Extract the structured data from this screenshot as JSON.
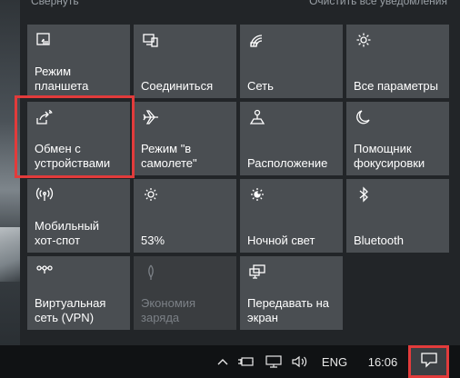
{
  "action_center": {
    "top_left_link": "Свернуть",
    "top_right_link": "Очистить все уведомления"
  },
  "tiles": [
    {
      "label": "Режим\nпланшета",
      "icon": "tablet-mode-icon",
      "disabled": false
    },
    {
      "label": "Соединиться",
      "icon": "connect-icon",
      "disabled": false
    },
    {
      "label": "Сеть",
      "icon": "network-icon",
      "disabled": false
    },
    {
      "label": "Все параметры",
      "icon": "gear-icon",
      "disabled": false
    },
    {
      "label": "Обмен с\nустройствами",
      "icon": "nearby-sharing-icon",
      "disabled": false,
      "highlighted": true
    },
    {
      "label": "Режим \"в\nсамолете\"",
      "icon": "airplane-icon",
      "disabled": false
    },
    {
      "label": "Расположение",
      "icon": "location-icon",
      "disabled": false
    },
    {
      "label": "Помощник\nфокусировки",
      "icon": "moon-icon",
      "disabled": false
    },
    {
      "label": "Мобильный\nхот-спот",
      "icon": "hotspot-icon",
      "disabled": false
    },
    {
      "label": "53%",
      "icon": "brightness-icon",
      "disabled": false
    },
    {
      "label": "Ночной свет",
      "icon": "night-light-icon",
      "disabled": false
    },
    {
      "label": "Bluetooth",
      "icon": "bluetooth-icon",
      "disabled": false
    },
    {
      "label": "Виртуальная\nсеть (VPN)",
      "icon": "vpn-icon",
      "disabled": false
    },
    {
      "label": "Экономия\nзаряда",
      "icon": "battery-saver-icon",
      "disabled": true
    },
    {
      "label": "Передавать на\nэкран",
      "icon": "project-icon",
      "disabled": false
    }
  ],
  "taskbar": {
    "language": "ENG",
    "time": "16:06"
  },
  "colors": {
    "tile": "#4a4e52",
    "tile_disabled": "#3a3d40",
    "panel": "#222528",
    "taskbar": "#101214",
    "highlight": "#e23b3b"
  }
}
